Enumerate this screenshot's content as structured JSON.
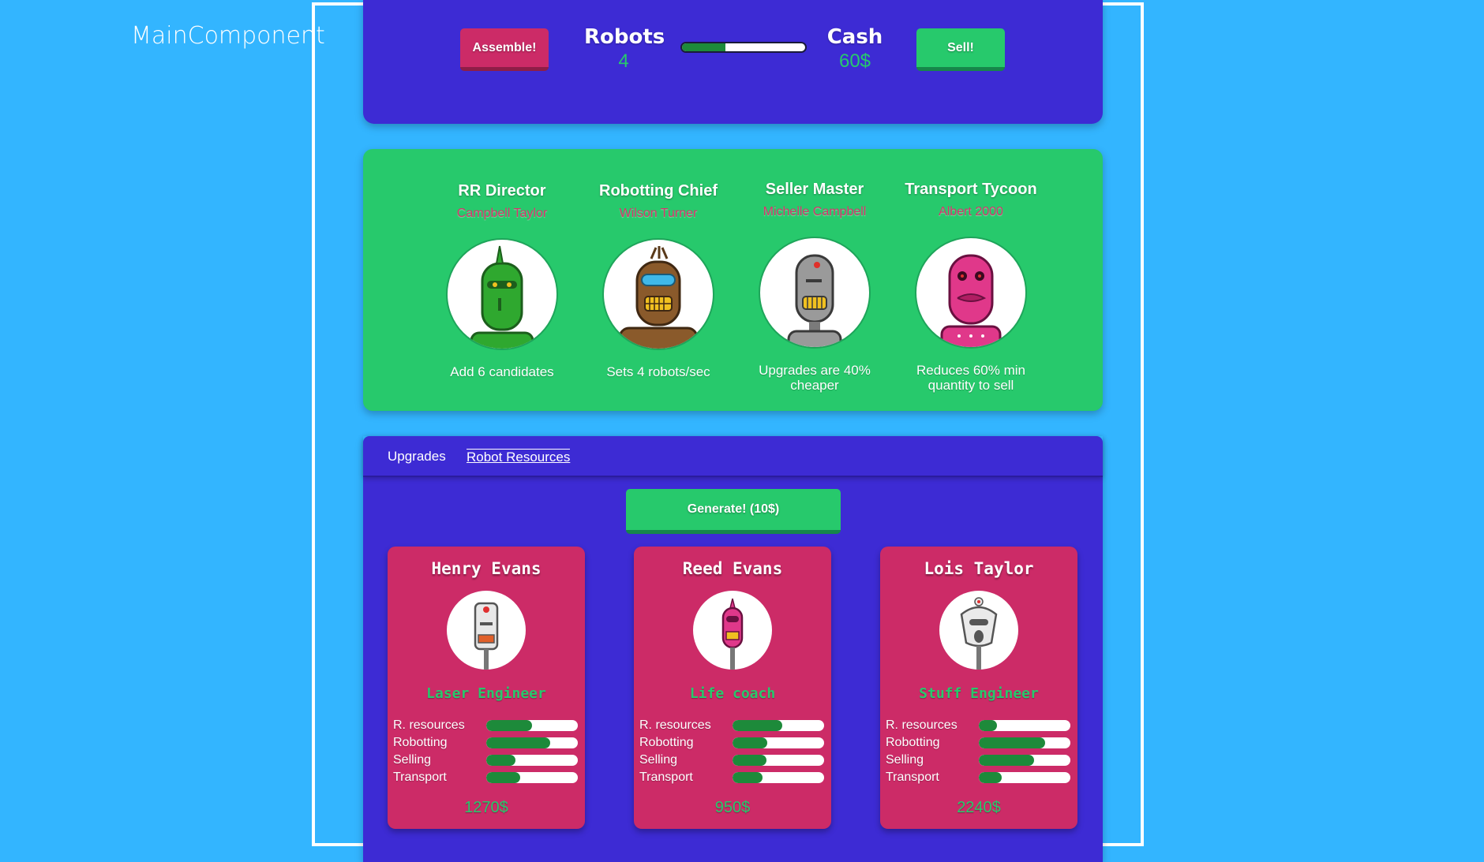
{
  "app": {
    "component_label": "MainComponent"
  },
  "top": {
    "assemble_label": "Assemble!",
    "robots_label": "Robots",
    "robots_value": "4",
    "cash_label": "Cash",
    "cash_value": "60$",
    "sell_label": "Sell!",
    "progress": 0.35
  },
  "executives": [
    {
      "title": "RR Director",
      "name": "Campbell Taylor",
      "desc": "Add 6 candidates",
      "color": "#2fa82f",
      "icon": "green-robot-icon"
    },
    {
      "title": "Robotting Chief",
      "name": "Wilson Turner",
      "desc": "Sets 4 robots/sec",
      "color": "#8a5a2b",
      "icon": "brown-robot-icon"
    },
    {
      "title": "Seller Master",
      "name": "Michelle Campbell",
      "desc": "Upgrades are 40% cheaper",
      "color": "#9a9a9a",
      "icon": "gray-robot-icon"
    },
    {
      "title": "Transport Tycoon",
      "name": "Albert 2000",
      "desc": "Reduces 60% min quantity to sell",
      "color": "#e0388a",
      "icon": "pink-robot-icon"
    }
  ],
  "tabs": {
    "upgrades": "Upgrades",
    "robot_resources": "Robot Resources"
  },
  "generate_label": "Generate! (10$)",
  "skill_labels": [
    "R. resources",
    "Robotting",
    "Selling",
    "Transport"
  ],
  "candidates": [
    {
      "name": "Henry Evans",
      "role": "Laser Engineer",
      "price": "1270$",
      "skills": [
        0.5,
        0.7,
        0.32,
        0.37
      ],
      "color": "#e8e8e8",
      "accent": "#e0602a",
      "icon": "white-robot-icon"
    },
    {
      "name": "Reed Evans",
      "role": "Life coach",
      "price": "950$",
      "skills": [
        0.54,
        0.38,
        0.37,
        0.33
      ],
      "color": "#e0388a",
      "accent": "#f0c020",
      "icon": "pink-robot-icon"
    },
    {
      "name": "Lois Taylor",
      "role": "Stuff Engineer",
      "price": "2240$",
      "skills": [
        0.2,
        0.72,
        0.6,
        0.25
      ],
      "color": "#eaeaea",
      "accent": "#555555",
      "icon": "white-robot-icon"
    }
  ]
}
